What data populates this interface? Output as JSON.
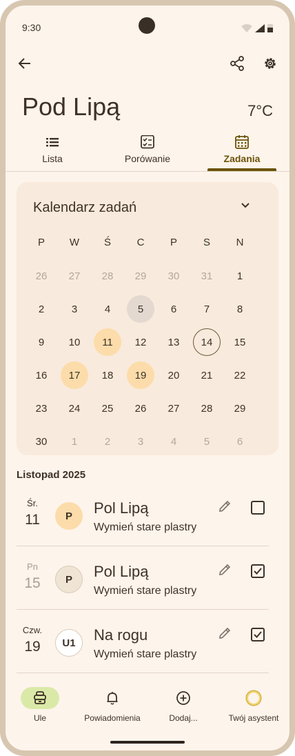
{
  "status_bar": {
    "time": "9:30"
  },
  "header": {
    "title": "Pod Lipą",
    "temperature": "7°C"
  },
  "tabs": [
    {
      "label": "Lista",
      "icon": "list-icon",
      "active": false
    },
    {
      "label": "Porówanie",
      "icon": "checklist-icon",
      "active": false
    },
    {
      "label": "Zadania",
      "icon": "calendar-icon",
      "active": true
    }
  ],
  "calendar": {
    "title": "Kalendarz zadań",
    "weekdays": [
      "P",
      "W",
      "Ś",
      "C",
      "P",
      "S",
      "N"
    ],
    "weeks": [
      [
        "26",
        "27",
        "28",
        "29",
        "30",
        "31",
        "1"
      ],
      [
        "2",
        "3",
        "4",
        "5",
        "6",
        "7",
        "8"
      ],
      [
        "9",
        "10",
        "11",
        "12",
        "13",
        "14",
        "15"
      ],
      [
        "16",
        "17",
        "18",
        "19",
        "20",
        "21",
        "22"
      ],
      [
        "23",
        "24",
        "25",
        "26",
        "27",
        "28",
        "29"
      ],
      [
        "30",
        "1",
        "2",
        "3",
        "4",
        "5",
        "6"
      ]
    ]
  },
  "section_title": "Listopad 2025",
  "tasks": [
    {
      "dow": "Śr.",
      "day": "11",
      "avatar": "P",
      "avatar_color": "#fcdcaa",
      "hive": "Pol Lipą",
      "description": "Wymień stare plastry",
      "checked": false
    },
    {
      "dow": "Pn",
      "day": "15",
      "avatar": "P",
      "avatar_color": "#f0e4d4",
      "hive": "Pol Lipą",
      "description": "Wymień stare plastry",
      "checked": true
    },
    {
      "dow": "Czw.",
      "day": "19",
      "avatar": "U1",
      "avatar_color": "#ffffff",
      "hive": "Na rogu",
      "description": "Wymień stare plastry",
      "checked": true
    }
  ],
  "bottom_nav": [
    {
      "label": "Ule",
      "icon": "hive-icon",
      "active": true
    },
    {
      "label": "Powiadomienia",
      "icon": "bell-icon",
      "active": false
    },
    {
      "label": "Dodaj...",
      "icon": "add-circle-icon",
      "active": false
    },
    {
      "label": "Twój asystent",
      "icon": "assistant-icon",
      "active": false
    }
  ],
  "colors": {
    "accent": "#6b5307",
    "highlight": "#fcdcaa",
    "background": "#fdf4ec",
    "nav_active": "#dbe9a8"
  }
}
